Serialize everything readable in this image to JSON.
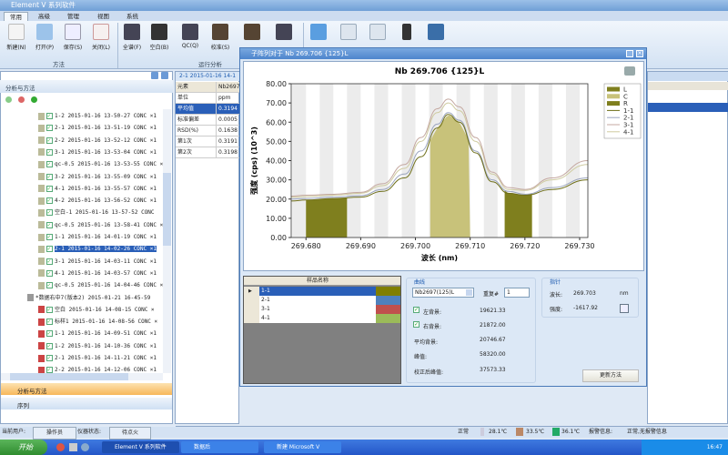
{
  "app": {
    "title": "Element V 系列软件"
  },
  "ribbon": {
    "tabs": [
      "常用",
      "高级",
      "管理",
      "视图",
      "系统"
    ],
    "buttons": [
      {
        "label": "新建(N)",
        "icon": "new-icon"
      },
      {
        "label": "打开(P)",
        "icon": "open-icon"
      },
      {
        "label": "保存(S)",
        "icon": "save-icon"
      },
      {
        "label": "关闭(L)",
        "icon": "close-file-icon"
      },
      {
        "label": "全谱(F)",
        "icon": "full-spectrum-icon"
      },
      {
        "label": "空白(B)",
        "icon": "blank-icon"
      },
      {
        "label": "QC(Q)",
        "icon": "qc-icon"
      },
      {
        "label": "校准(S)",
        "icon": "calibrate-icon"
      }
    ],
    "groups": [
      "方法",
      "运行分析"
    ]
  },
  "left": {
    "header": "分析与方法",
    "items": [
      {
        "text": "1-2 2015-01-16 13-50-27 CONC ×1"
      },
      {
        "text": "2-1 2015-01-16 13-51-19 CONC ×1"
      },
      {
        "text": "2-2 2015-01-16 13-52-12 CONC ×1"
      },
      {
        "text": "3-1 2015-01-16 13-53-04 CONC ×1"
      },
      {
        "text": "qc-0.5 2015-01-16 13-53-55 CONC ×"
      },
      {
        "text": "3-2 2015-01-16 13-55-09 CONC ×1"
      },
      {
        "text": "4-1 2015-01-16 13-55-57 CONC ×1"
      },
      {
        "text": "4-2 2015-01-16 13-56-52 CONC ×1"
      },
      {
        "text": "空白-1 2015-01-16 13-57-52 CONC"
      },
      {
        "text": "qc-0.5 2015-01-16 13-58-41 CONC ×"
      },
      {
        "text": "1-1 2015-01-16 14-01-19 CONC ×1"
      },
      {
        "text": "2-1 2015-01-16 14-02-26 CONC ×1"
      },
      {
        "text": "3-1 2015-01-16 14-03-11 CONC ×1"
      },
      {
        "text": "4-1 2015-01-16 14-03-57 CONC ×1"
      },
      {
        "text": "qc-0.5 2015-01-16 14-04-46 CONC ×"
      },
      {
        "text": "*数据右中7(版本2) 2015-01-21 16-45-59",
        "group": true
      },
      {
        "text": "空白 2015-01-16 14-08-15 CONC ×"
      },
      {
        "text": "标样1 2015-01-16 14-08-56 CONC ×"
      },
      {
        "text": "1-1 2015-01-16 14-09-51 CONC ×1"
      },
      {
        "text": "1-2 2015-01-16 14-10-36 CONC ×1"
      },
      {
        "text": "2-1 2015-01-16 14-11-21 CONC ×1"
      },
      {
        "text": "2-2 2015-01-16 14-12-06 CONC ×1"
      }
    ],
    "accordion": [
      "分析与方法",
      "序列"
    ]
  },
  "mid": {
    "header": "2-1 2015-01-16 14-1",
    "rows": [
      [
        "元素",
        "Nb2697"
      ],
      [
        "单位",
        "ppm"
      ],
      [
        "平均值",
        "0.3194"
      ],
      [
        "标准偏差",
        "0.0005"
      ],
      [
        "RSD(%)",
        "0.1638"
      ],
      [
        "第1次",
        "0.3191"
      ],
      [
        "第2次",
        "0.3198"
      ]
    ]
  },
  "dialog": {
    "title": "子阵列对于 Nb 269.706 {125}L",
    "samples_header": "样品名称",
    "samples": [
      {
        "name": "1-1",
        "color": "#807f00"
      },
      {
        "name": "2-1",
        "color": "#4f81bd"
      },
      {
        "name": "3-1",
        "color": "#c0504d"
      },
      {
        "name": "4-1",
        "color": "#9bbb59"
      }
    ],
    "curve": {
      "title": "曲线",
      "element": "Nb2697(125)L",
      "repeat_label": "重复#",
      "repeat": "1",
      "left_bg_label": "左背景:",
      "left_bg": "19621.33",
      "right_bg_label": "右背景:",
      "right_bg": "21872.00",
      "avg_bg_label": "平均背景:",
      "avg_bg": "20746.67",
      "peak_label": "峰值:",
      "peak": "58320.00",
      "corr_label": "校正后峰值:",
      "corr": "37573.33"
    },
    "pointer": {
      "title": "指针",
      "wl_label": "波长:",
      "wl": "269.703",
      "wl_unit": "nm",
      "int_label": "强度:",
      "int": "-1617.92"
    },
    "update_button": "更新方法"
  },
  "chart_data": {
    "type": "line",
    "title": "Nb 269.706 {125}L",
    "xlabel": "波长 (nm)",
    "ylabel": "强度 (cps) (10^3)",
    "xlim": [
      269.6773,
      269.7315
    ],
    "ylim": [
      0,
      80
    ],
    "xticks": [
      "269.680",
      "269.690",
      "269.700",
      "269.710",
      "269.720",
      "269.730"
    ],
    "yticks": [
      "0.00",
      "10.00",
      "20.00",
      "30.00",
      "40.00",
      "50.00",
      "60.00",
      "70.00",
      "80.00"
    ],
    "regions": [
      {
        "name": "L",
        "from": 269.68,
        "to": 269.6875,
        "color": "#7f7f1e"
      },
      {
        "name": "C",
        "from": 269.7027,
        "to": 269.71,
        "color": "#c8c27a"
      },
      {
        "name": "R",
        "from": 269.7163,
        "to": 269.7213,
        "color": "#7f7f1e"
      }
    ],
    "x": [
      269.6773,
      269.68,
      269.685,
      269.69,
      269.694,
      269.698,
      269.701,
      269.704,
      269.706,
      269.708,
      269.711,
      269.714,
      269.717,
      269.72,
      269.725,
      269.7315
    ],
    "series": [
      {
        "name": "1-1",
        "color": "#6f6f1a",
        "values": [
          19,
          19.5,
          20.3,
          21,
          24,
          31,
          42,
          57,
          64,
          60,
          44,
          29,
          23,
          22,
          25,
          30
        ]
      },
      {
        "name": "2-1",
        "color": "#9aa4be",
        "values": [
          20,
          20.3,
          21,
          21.8,
          25,
          33,
          45,
          59,
          65,
          61,
          45,
          30,
          24,
          22.5,
          26,
          31
        ]
      },
      {
        "name": "3-1",
        "color": "#c4a8a0",
        "values": [
          21.5,
          22,
          22.5,
          23.5,
          28,
          38,
          52,
          67,
          72,
          68,
          52,
          34,
          26,
          25,
          31,
          40
        ]
      },
      {
        "name": "4-1",
        "color": "#cfcba0",
        "values": [
          21,
          21.3,
          22,
          23,
          27,
          36,
          50,
          65,
          70,
          66,
          50,
          33,
          25,
          24.5,
          30,
          38
        ]
      }
    ],
    "legend": "right"
  },
  "status": {
    "user_label": "当前用户:",
    "user": "操作员",
    "inst_label": "仪器状态:",
    "inst": "待点火",
    "state": "正常",
    "t1": "28.1℃",
    "t2": "33.5℃",
    "t3": "36.1℃",
    "alarm_label": "报警信息:",
    "alarm": "正常,无报警信息"
  },
  "taskbar": {
    "start": "开始",
    "tasks": [
      "Element V 系列软件",
      "数据后",
      "新建 Microsoft V"
    ],
    "clock": "16:47"
  }
}
